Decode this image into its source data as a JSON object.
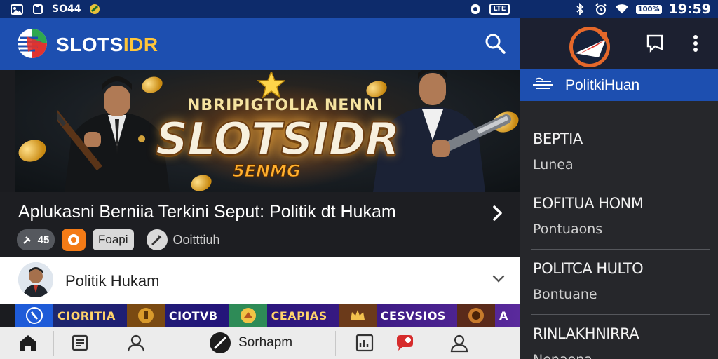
{
  "status_bar": {
    "left_text": "SO44",
    "right_box": "LTE",
    "battery_chip": "100%",
    "time": "19:59"
  },
  "app_bar": {
    "brand_part1": "SLOTS",
    "brand_part2": "IDR"
  },
  "hero": {
    "top_text": "NBRIPIGTOLIA NENNI",
    "big_text": "SLOTSIDR",
    "sub_text": "5ENMG"
  },
  "article": {
    "title": "Aplukasni Berniia Terkini Seput: Politik dt Hukam",
    "chip_count": "45",
    "chip_label": "Foapi",
    "chip_text": "Ooitttiuh"
  },
  "section": {
    "title": "Politik Hukam"
  },
  "categories": [
    {
      "label": "CIORITIA"
    },
    {
      "label": "CIOTVB"
    },
    {
      "label": "CEAPIAS"
    },
    {
      "label": "CESVSIOS"
    },
    {
      "label": "A"
    }
  ],
  "bottom_nav": {
    "center_label": "Sorhapm"
  },
  "drawer": {
    "header_title": "PolitkiHuan",
    "items": [
      {
        "title": "BEPTIA",
        "subtitle": "Lunea"
      },
      {
        "title": "EOFITUA HONM",
        "subtitle": "Pontuaons"
      },
      {
        "title": "POLITCA HULTO",
        "subtitle": "Bontuane"
      },
      {
        "title": "RINLAKHNIRRA",
        "subtitle": "Nenaona"
      }
    ]
  },
  "colors": {
    "app_bar": "#1d4fb0",
    "status_bar": "#0d2b6b",
    "accent_gold": "#ffc53a",
    "drawer_bg": "#26272b"
  }
}
